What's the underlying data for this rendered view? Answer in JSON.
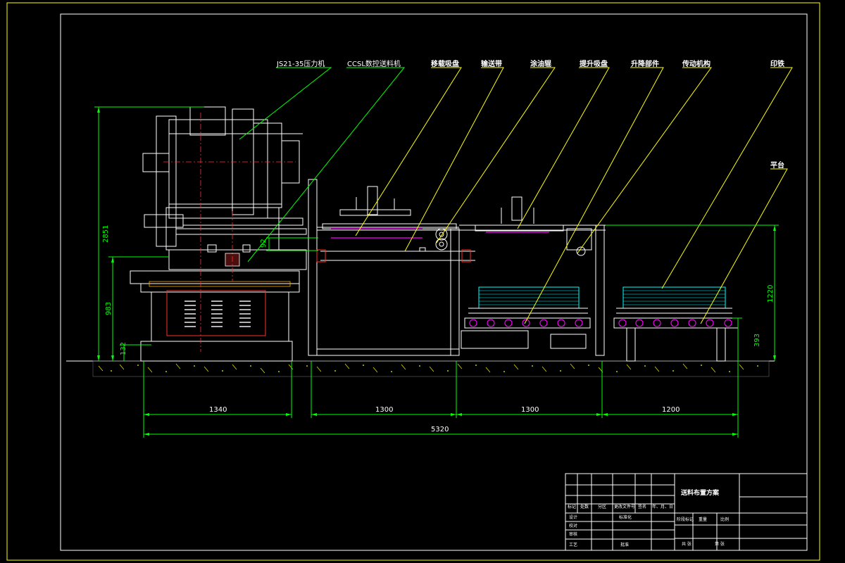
{
  "drawing": {
    "title": "送料布置方案",
    "callouts": [
      {
        "id": "press",
        "text": "JS21-35压力机"
      },
      {
        "id": "feeder",
        "text": "CCSL数控送料机"
      },
      {
        "id": "sucker",
        "text": "移载吸盘"
      },
      {
        "id": "conveyor",
        "text": "输送带"
      },
      {
        "id": "oiler",
        "text": "涂油辊"
      },
      {
        "id": "lift-sucker",
        "text": "提升吸盘"
      },
      {
        "id": "lift-unit",
        "text": "升降部件"
      },
      {
        "id": "drive",
        "text": "传动机构"
      },
      {
        "id": "sheet",
        "text": "印铁"
      },
      {
        "id": "platform",
        "text": "平台"
      }
    ],
    "dimensions": {
      "total_height": "2851",
      "press_table_height": "983",
      "base_height": "132",
      "feed_offset": "92",
      "stack_height": "1220",
      "platform_height": "393",
      "press_length": "1340",
      "section_a": "1300",
      "section_b": "1300",
      "section_c": "1200",
      "total_length": "5320"
    }
  },
  "title_block": {
    "drawing_title": "送料布置方案",
    "row_labels": [
      "标记",
      "处数",
      "分区",
      "更改文件号",
      "签名",
      "年、月、日"
    ],
    "design": "设计",
    "standardization": "标准化",
    "check": "校对",
    "review": "审核",
    "process": "工艺",
    "approve": "批准",
    "stage_mark": "阶段标记",
    "weight": "重量",
    "scale": "比例",
    "sheets_total": "共 张",
    "sheet_no": "第 张"
  }
}
